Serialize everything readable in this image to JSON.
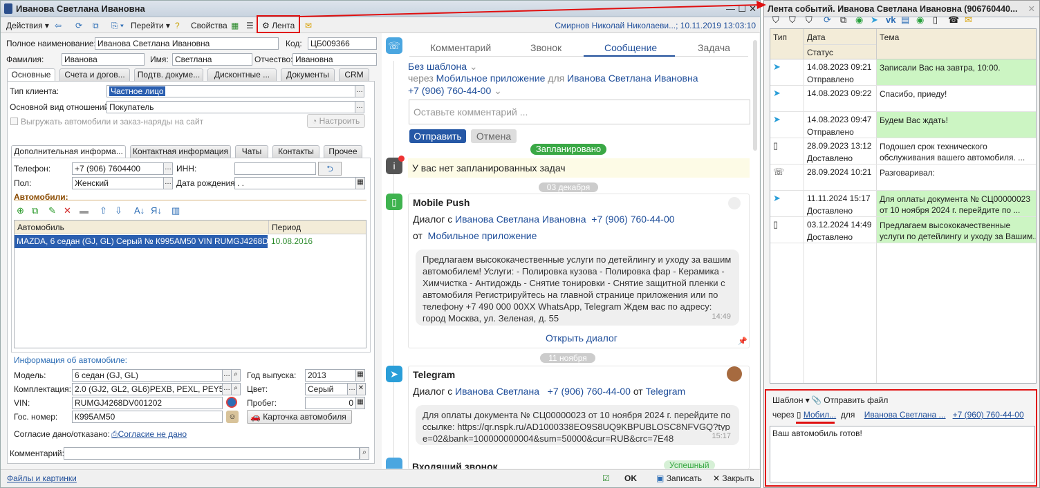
{
  "main_window": {
    "title": "Иванова Светлана Ивановна",
    "toolbar": {
      "actions": "Действия",
      "goto": "Перейти",
      "properties": "Свойства",
      "feed": "Лента",
      "user_info": "Смирнов Николай Николаеви...; 10.11.2019 13:03:10"
    },
    "fields": {
      "full_name_label": "Полное наименование:",
      "full_name": "Иванова Светлана Ивановна",
      "code_label": "Код:",
      "code": "ЦБ009366",
      "last_name_label": "Фамилия:",
      "last_name": "Иванова",
      "first_name_label": "Имя:",
      "first_name": "Светлана",
      "patronymic_label": "Отчество:",
      "patronymic": "Ивановна"
    },
    "tabs": [
      "Основные",
      "Счета и догов...",
      "Подтв. докуме...",
      "Дисконтные ...",
      "Документы",
      "CRM"
    ],
    "main_tab": {
      "client_type_label": "Тип клиента:",
      "client_type": "Частное лицо",
      "relation_label": "Основной вид отношений:",
      "relation": "Покупатель",
      "upload_label": "Выгружать автомобили и заказ-наряды на сайт",
      "configure": "Настроить"
    },
    "subtabs": [
      "Дополнительная информа...",
      "Контактная информация",
      "Чаты",
      "Контакты",
      "Прочее"
    ],
    "extra": {
      "phone_label": "Телефон:",
      "phone": "+7 (906) 7604400",
      "inn_label": "ИНН:",
      "inn": "",
      "gender_label": "Пол:",
      "gender": "Женский",
      "birth_label": "Дата рождения:",
      "birth": " .  .",
      "cars_label": "Автомобили:",
      "col_car": "Автомобиль",
      "col_period": "Период",
      "car_row": "MAZDA, 6 седан (GJ, GL) Серый № К995АМ50 VIN RUMGJ4268DV001...",
      "car_period": "10.08.2016"
    },
    "car_info": {
      "header": "Информация об автомобиле:",
      "model_label": "Модель:",
      "model": "6 седан (GJ, GL)",
      "year_label": "Год выпуска:",
      "year": "2013",
      "equip_label": "Комплектация:",
      "equip": "2.0 (GJ2, GL2, GL6)PEXB, PEXL, PEY5, PEY",
      "color_label": "Цвет:",
      "color": "Серый",
      "vin_label": "VIN:",
      "vin": "RUMGJ4268DV001202",
      "mileage_label": "Пробег:",
      "mileage": "0",
      "plate_label": "Гос. номер:",
      "plate": "К995АМ50",
      "card_button": "Карточка автомобиля",
      "consent_label": "Согласие дано/отказано:",
      "consent_link": "Согласие не дано"
    },
    "comment_label": "Комментарий:",
    "footer": {
      "files_link": "Файлы и картинки",
      "ok": "OK",
      "save": "Записать",
      "close": "Закрыть"
    }
  },
  "feed": {
    "tabs": [
      "Комментарий",
      "Звонок",
      "Сообщение",
      "Задача"
    ],
    "template": "Без шаблона",
    "via": "через",
    "via_channel": "Мобильное приложение",
    "for": "для",
    "for_name": "Иванова Светлана Ивановна",
    "phone": "+7 (906) 760-44-00",
    "comment_placeholder": "Оставьте комментарий ...",
    "send": "Отправить",
    "cancel": "Отмена",
    "planned_badge": "Запланировано",
    "no_tasks": "У вас нет запланированных задач",
    "date1": "03 декабря",
    "push_title": "Mobile Push",
    "push_dialog": "Диалог с",
    "push_name": "Иванова Светлана Ивановна",
    "push_phone": "+7 (906) 760-44-00",
    "push_from": "от",
    "push_source": "Мобильное приложение",
    "push_text": "Предлагаем высококачественные услуги по детейлингу и уходу за вашим автомобилем! Услуги: - Полировка кузова - Полировка фар - Керамика - Химчистка - Антидождь - Снятие тонировки - Снятие защитной пленки с автомобиля  Регистрируйтесь на главной странице приложения или по телефону +7 490 000 00ХХ WhatsApp, Telegram Ждем вас по адресу: город Москва, ул. Зеленая, д. 55",
    "push_time": "14:49",
    "open_dialog": "Открыть диалог",
    "date2": "11 ноября",
    "tg_title": "Telegram",
    "tg_dialog": "Диалог с",
    "tg_name": "Иванова Светлана",
    "tg_phone": "+7 (906) 760-44-00",
    "tg_from": "от",
    "tg_source": "Telegram",
    "tg_text": "Для оплаты документа № СЦ00000023 от 10 ноября 2024 г. перейдите по ссылке: https://qr.nspk.ru/AD1000338EO9S8UQ9KBPUBLOSC8NFVGQ?type=02&bank=100000000004&sum=50000&cur=RUB&crc=7E48",
    "tg_time": "15:17",
    "incoming_call": "Входящий звонок",
    "call_badge": "Успешный"
  },
  "events_window": {
    "title": "Лента событий. Иванова Светлана Ивановна (906760440...",
    "col_type": "Тип",
    "col_date": "Дата",
    "col_status": "Статус",
    "col_subject": "Тема",
    "rows": [
      {
        "icon": "telegram",
        "date": "14.08.2023 09:21",
        "status": "Отправлено",
        "subject": "Записали Вас на завтра, 10:00.",
        "subject2": "",
        "green": true
      },
      {
        "icon": "telegram",
        "date": "14.08.2023 09:22",
        "status": "",
        "subject": "Спасибо, приеду!",
        "subject2": "",
        "green": false
      },
      {
        "icon": "telegram",
        "date": "14.08.2023 09:47",
        "status": "Отправлено",
        "subject": "Будем Вас ждать!",
        "subject2": "",
        "green": true
      },
      {
        "icon": "mobile",
        "date": "28.09.2023 13:12",
        "status": "Доставлено",
        "subject": "Подошел срок технического",
        "subject2": "обслуживания вашего автомобиля. ...",
        "green": false
      },
      {
        "icon": "call",
        "date": "28.09.2024 10:21",
        "status": "",
        "subject": "Разговаривал:",
        "subject2": "",
        "green": false
      },
      {
        "icon": "telegram",
        "date": "11.11.2024 15:17",
        "status": "Доставлено",
        "subject": "Для оплаты документа № СЦ00000023",
        "subject2": "от 10 ноября 2024 г. перейдите по ...",
        "green": true
      },
      {
        "icon": "mobile",
        "date": "03.12.2024 14:49",
        "status": "Доставлено",
        "subject": "Предлагаем высококачественные",
        "subject2": "услуги по детейлингу и уходу за Вашим...",
        "green": true
      }
    ],
    "template": "Шаблон",
    "send_file": "Отправить файл",
    "via": "через",
    "via_channel": "Мобил...",
    "for": "для",
    "for_name": "Иванова Светлана ...",
    "phone": "+7 (960) 760-44-00",
    "message": "Ваш автомобиль готов!"
  }
}
